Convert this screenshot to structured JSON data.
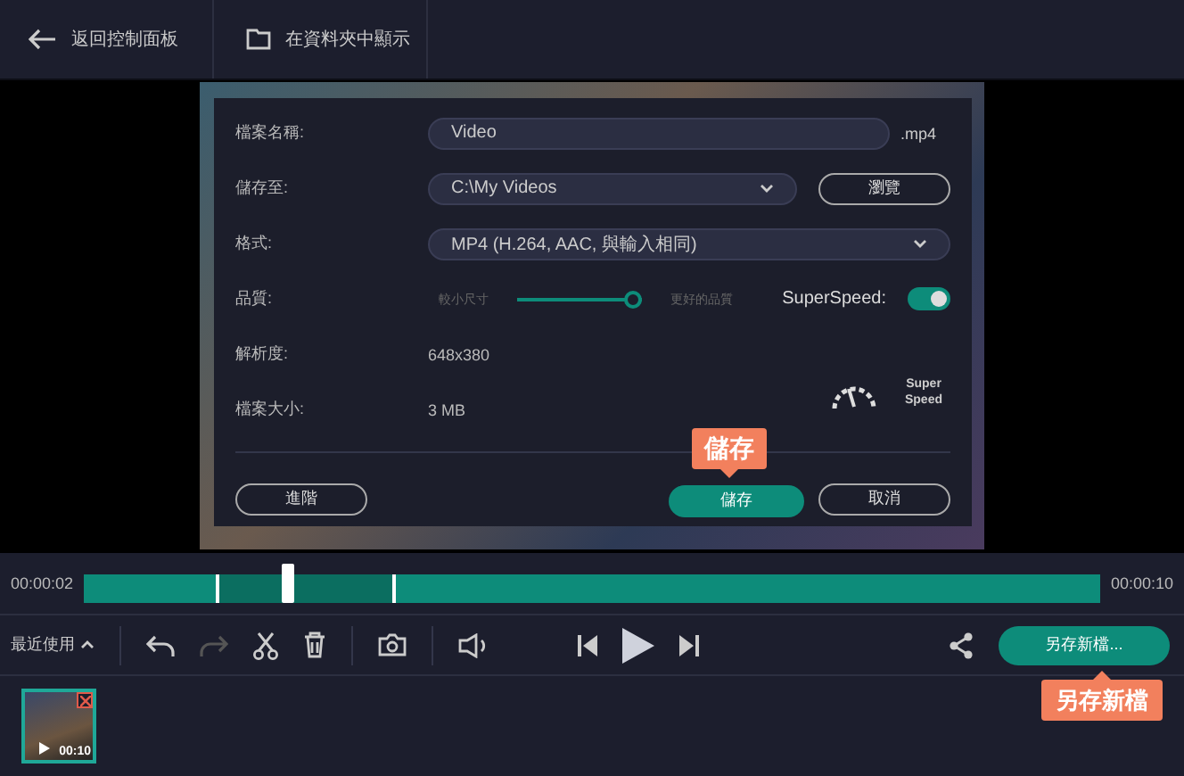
{
  "top_bar": {
    "back": {
      "label": "返回控制面板"
    },
    "show_in_folder": {
      "label": "在資料夾中顯示"
    }
  },
  "dialog": {
    "fields": [
      {
        "kind": "text",
        "label": "檔案名稱:",
        "value": "Video",
        "suffix": ".mp4"
      },
      {
        "kind": "path",
        "label": "儲存至:",
        "value": "C:\\My Videos",
        "button": "瀏覽"
      },
      {
        "kind": "select",
        "label": "格式:",
        "value": "MP4 (H.264, AAC, 與輸入相同)"
      },
      {
        "kind": "quality",
        "label": "品質:",
        "min_label": "較小尺寸",
        "max_label": "更好的品質",
        "level": 1.0,
        "toggle_label": "SuperSpeed:",
        "toggle_on": true
      }
    ],
    "info": [
      {
        "label": "解析度:",
        "value": "648x380"
      },
      {
        "label": "檔案大小:",
        "value": "3 MB"
      }
    ],
    "badge": "Super Speed",
    "buttons": {
      "advanced": "進階",
      "save": "儲存",
      "cancel": "取消"
    }
  },
  "timeline": {
    "start": "00:00:02",
    "end": "00:00:10",
    "playhead": {
      "level": 0.2
    }
  },
  "toolbar": {
    "recent": "最近使用",
    "save_as": "另存新檔..."
  },
  "clip": {
    "duration": "00:10"
  },
  "callouts": [
    {
      "kind": "save",
      "text": "儲存"
    },
    {
      "kind": "save_as",
      "text": "另存新檔"
    }
  ]
}
